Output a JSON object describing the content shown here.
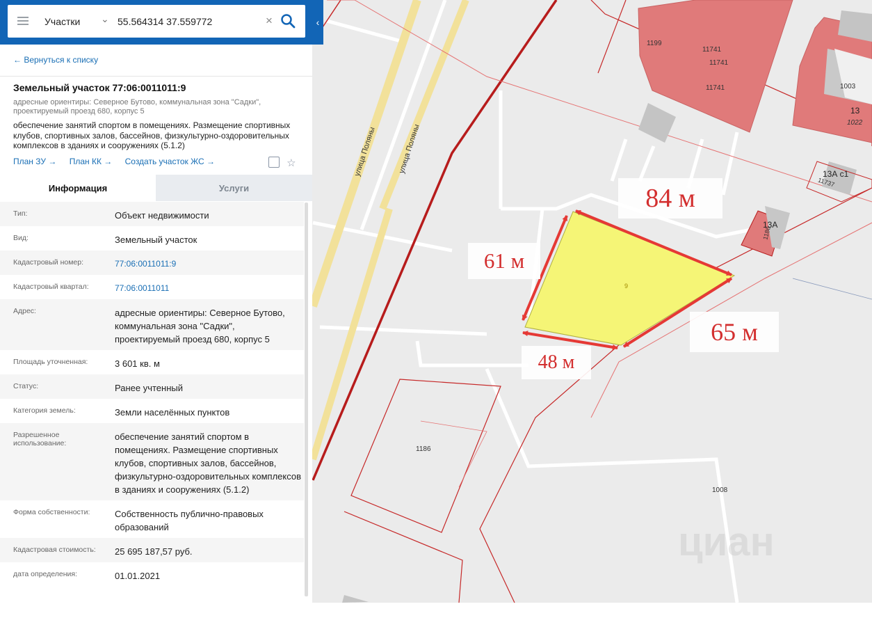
{
  "search": {
    "layer": "Участки",
    "query": "55.564314 37.559772"
  },
  "panel": {
    "back_link": "← Вернуться к списку",
    "title": "Земельный участок 77:06:0011011:9",
    "address_small": "адресные ориентиры: Северное Бутово, коммунальная зона \"Садки\", проектируемый проезд 680, корпус 5",
    "use": "обеспечение занятий спортом в помещениях. Размещение спортивных клубов, спортивных залов, бассейнов, физкультурно-оздоровительных комплексов в зданиях и сооружениях (5.1.2)",
    "links": [
      "План ЗУ →",
      "План КК →",
      "Создать участок ЖС →"
    ],
    "tabs": [
      "Информация",
      "Услуги"
    ],
    "rows": [
      {
        "label": "Тип:",
        "value": "Объект недвижимости"
      },
      {
        "label": "Вид:",
        "value": "Земельный участок"
      },
      {
        "label": "Кадастровый номер:",
        "value": "77:06:0011011:9",
        "link": true
      },
      {
        "label": "Кадастровый квартал:",
        "value": "77:06:0011011",
        "link": true
      },
      {
        "label": "Адрес:",
        "value": "адресные ориентиры: Северное Бутово, коммунальная зона \"Садки\", проектируемый проезд 680, корпус 5"
      },
      {
        "label": "Площадь уточненная:",
        "value": "3 601 кв. м"
      },
      {
        "label": "Статус:",
        "value": "Ранее учтенный"
      },
      {
        "label": "Категория земель:",
        "value": "Земли населённых пунктов"
      },
      {
        "label": "Разрешенное использование:",
        "value": "обеспечение занятий спортом в помещениях. Размещение спортивных клубов, спортивных залов, бассейнов, физкультурно-оздоровительных комплексов в зданиях и сооружениях (5.1.2)"
      },
      {
        "label": "Форма собственности:",
        "value": "Собственность публично-правовых образований"
      },
      {
        "label": "Кадастровая стоимость:",
        "value": "25 695 187,57 руб."
      },
      {
        "label": "дата определения:",
        "value": "01.01.2021"
      }
    ]
  },
  "map": {
    "streets": [
      "улица Поляны",
      "улица Поляны"
    ],
    "parcel_labels": [
      "1199",
      "11741",
      "11741",
      "11741",
      "1003",
      "13",
      "1022",
      "13А с1",
      "11737",
      "13А",
      "1186",
      "1008",
      "1186",
      "9"
    ],
    "measurements": [
      "84 м",
      "61 м",
      "65 м",
      "48 м"
    ],
    "watermark": "циан"
  },
  "colors": {
    "header": "#1265b6",
    "link": "#1a6fb5",
    "building": "#e07a7a",
    "parcel": "#f5f576",
    "arrow": "#e53935",
    "boundary": "#c62828"
  }
}
